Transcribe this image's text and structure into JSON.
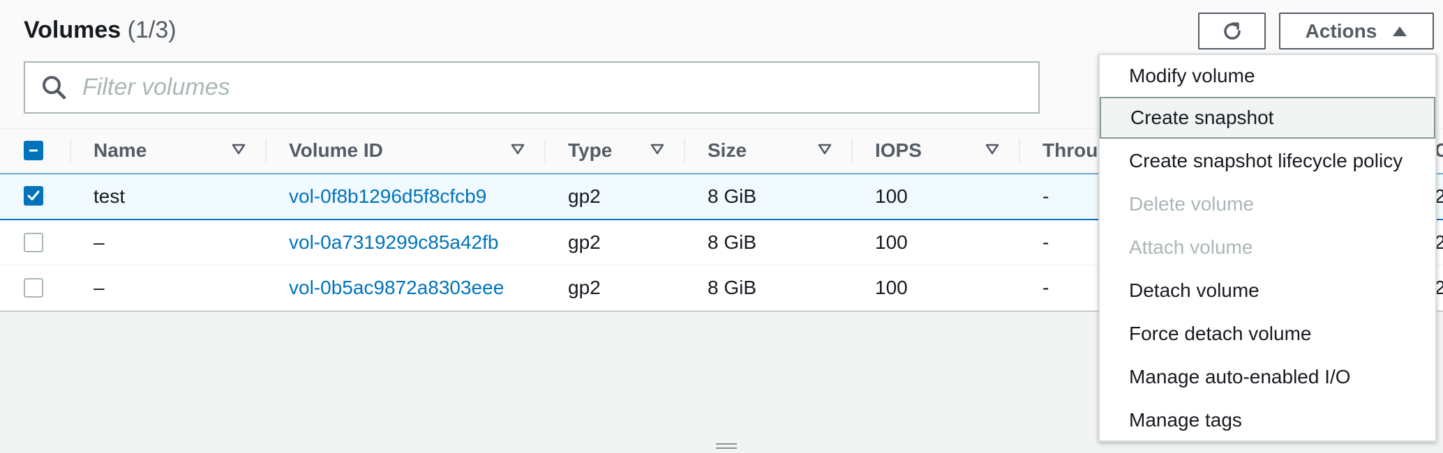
{
  "header": {
    "title": "Volumes",
    "count": "(1/3)"
  },
  "buttons": {
    "refresh_icon": "refresh-icon",
    "actions_label": "Actions",
    "actions_icon": "caret-up-icon"
  },
  "search": {
    "placeholder": "Filter volumes",
    "value": ""
  },
  "table": {
    "columns": [
      "Name",
      "Volume ID",
      "Type",
      "Size",
      "IOPS",
      "Throu",
      "C"
    ],
    "rows": [
      {
        "selected": true,
        "name": "test",
        "volume_id": "vol-0f8b1296d5f8cfcb9",
        "type": "gp2",
        "size": "8 GiB",
        "iops": "100",
        "throughput": "-",
        "extra": "2"
      },
      {
        "selected": false,
        "name": "–",
        "volume_id": "vol-0a7319299c85a42fb",
        "type": "gp2",
        "size": "8 GiB",
        "iops": "100",
        "throughput": "-",
        "extra": "2"
      },
      {
        "selected": false,
        "name": "–",
        "volume_id": "vol-0b5ac9872a8303eee",
        "type": "gp2",
        "size": "8 GiB",
        "iops": "100",
        "throughput": "-",
        "extra": "2"
      }
    ]
  },
  "actions_menu": {
    "items": [
      {
        "label": "Modify volume",
        "state": "enabled"
      },
      {
        "label": "Create snapshot",
        "state": "hover"
      },
      {
        "label": "Create snapshot lifecycle policy",
        "state": "enabled"
      },
      {
        "label": "Delete volume",
        "state": "disabled"
      },
      {
        "label": "Attach volume",
        "state": "disabled"
      },
      {
        "label": "Detach volume",
        "state": "enabled"
      },
      {
        "label": "Force detach volume",
        "state": "enabled"
      },
      {
        "label": "Manage auto-enabled I/O",
        "state": "enabled"
      },
      {
        "label": "Manage tags",
        "state": "enabled"
      }
    ]
  },
  "colors": {
    "link": "#0073bb",
    "selected_border": "#0073bb",
    "disabled_text": "#aab7b8",
    "button_border": "#545b64"
  }
}
